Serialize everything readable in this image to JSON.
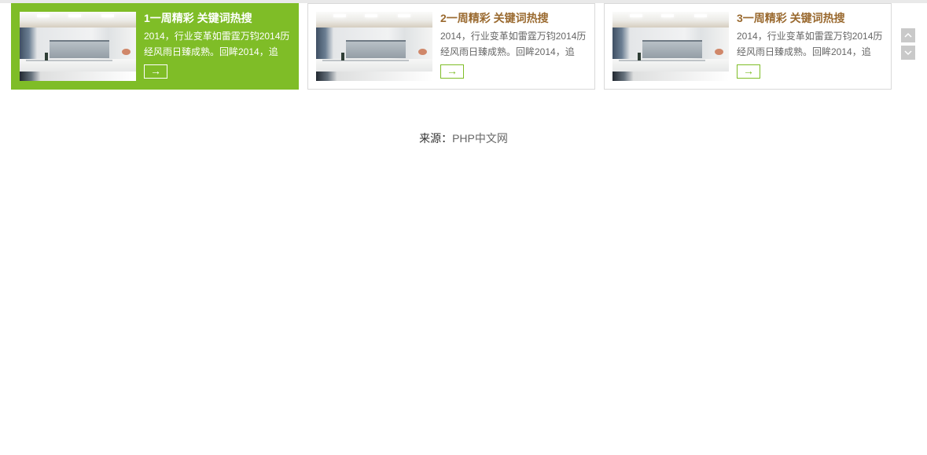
{
  "cards": [
    {
      "title": "1一周精彩 关键词热搜",
      "description": "2014，行业变革如雷霆万钧2014历经风雨日臻成熟。回眸2014，追",
      "more_label": "→",
      "active": true
    },
    {
      "title": "2一周精彩 关键词热搜",
      "description": "2014，行业变革如雷霆万钧2014历经风雨日臻成熟。回眸2014，追",
      "more_label": "→",
      "active": false
    },
    {
      "title": "3一周精彩 关键词热搜",
      "description": "2014，行业变革如雷霆万钧2014历经风雨日臻成熟。回眸2014，追",
      "more_label": "→",
      "active": false
    }
  ],
  "navigation": {
    "up_icon": "chevron-up-icon",
    "down_icon": "chevron-down-icon"
  },
  "footer": {
    "source_label": "来源：",
    "source_link": "PHP中文网"
  },
  "colors": {
    "accent": "#7fbd27",
    "title_brown": "#9a6a30",
    "border": "#d9d9d9",
    "nav_button": "#c9c9c9"
  }
}
